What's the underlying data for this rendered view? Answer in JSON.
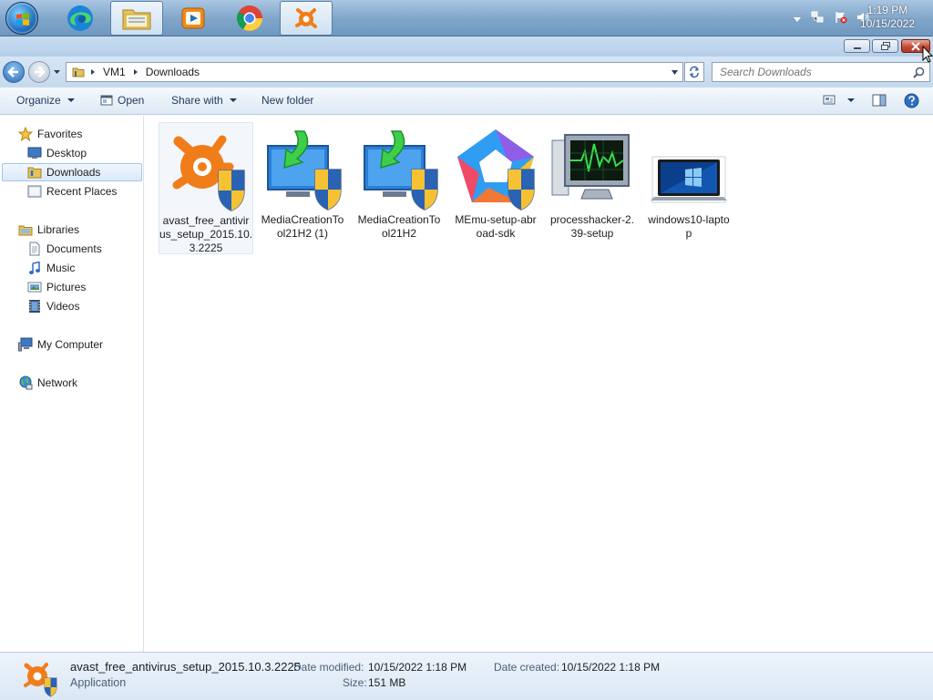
{
  "taskbar": {
    "apps": [
      {
        "name": "Microsoft Edge"
      },
      {
        "name": "Windows Explorer",
        "active": true
      },
      {
        "name": "Windows Media Player"
      },
      {
        "name": "Google Chrome"
      },
      {
        "name": "avast! Free Antivirus",
        "active": true
      }
    ],
    "clock": {
      "time": "1:19 PM",
      "date": "10/15/2022"
    }
  },
  "window": {
    "breadcrumb": [
      "VM1",
      "Downloads"
    ],
    "search_placeholder": "Search Downloads",
    "toolbar": {
      "organize": "Organize",
      "open": "Open",
      "share_with": "Share with",
      "new_folder": "New folder"
    },
    "nav": {
      "favorites": {
        "label": "Favorites",
        "items": [
          "Desktop",
          "Downloads",
          "Recent Places"
        ]
      },
      "libraries": {
        "label": "Libraries",
        "items": [
          "Documents",
          "Music",
          "Pictures",
          "Videos"
        ]
      },
      "computer": "My Computer",
      "network": "Network"
    },
    "files": [
      {
        "name": "avast_free_antivirus_setup_2015.10.3.2225",
        "lines": [
          "avast_free_antivir",
          "us_setup_2015.10.",
          "3.2225"
        ],
        "icon": "avast-installer-icon",
        "selected": true
      },
      {
        "name": "MediaCreationTool21H2 (1)",
        "lines": [
          "MediaCreationTo",
          "ol21H2 (1)"
        ],
        "icon": "media-creation-tool-icon"
      },
      {
        "name": "MediaCreationTool21H2",
        "lines": [
          "MediaCreationTo",
          "ol21H2"
        ],
        "icon": "media-creation-tool-icon"
      },
      {
        "name": "MEmu-setup-abroad-sdk",
        "lines": [
          "MEmu-setup-abr",
          "oad-sdk"
        ],
        "icon": "memu-installer-icon"
      },
      {
        "name": "processhacker-2.39-setup",
        "lines": [
          "processhacker-2.",
          "39-setup"
        ],
        "icon": "process-hacker-icon"
      },
      {
        "name": "windows10-laptop",
        "lines": [
          "windows10-lapto",
          "p"
        ],
        "icon": "windows10-laptop-thumbnail"
      }
    ],
    "details": {
      "filename": "avast_free_antivirus_setup_2015.10.3.2225",
      "type": "Application",
      "date_modified_label": "Date modified:",
      "date_modified": "10/15/2022 1:18 PM",
      "date_created_label": "Date created:",
      "date_created": "10/15/2022 1:18 PM",
      "size_label": "Size:",
      "size": "151 MB"
    }
  },
  "colors": {
    "accent": "#1e395b",
    "selection": "#dce9f8",
    "avast_orange": "#f07d1a"
  }
}
